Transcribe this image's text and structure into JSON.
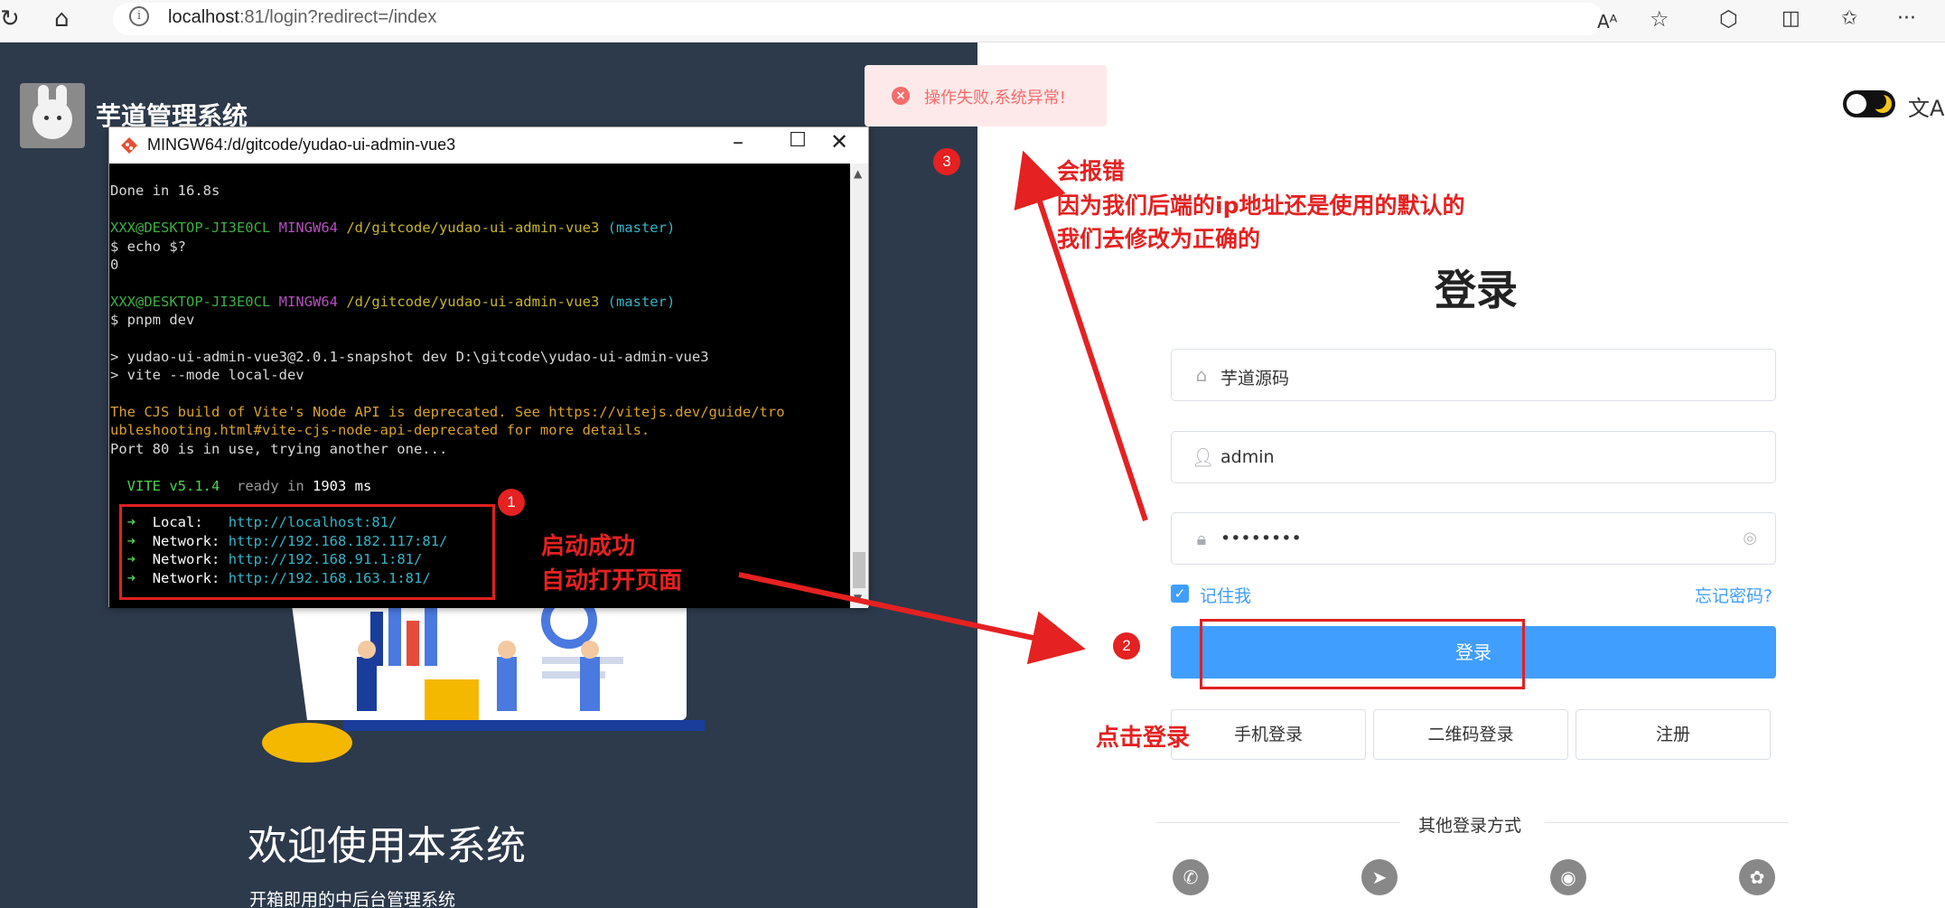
{
  "browser": {
    "url_host": "localhost",
    "url_rest": ":81/login?redirect=/index"
  },
  "left": {
    "app_title": "芋道管理系统",
    "welcome": "欢迎使用本系统",
    "welcome_sub": "开箱即用的中后台管理系统"
  },
  "terminal": {
    "title": "MINGW64:/d/gitcode/yudao-ui-admin-vue3",
    "lines": {
      "done": "Done in 16.8s",
      "user1": "XXX@DESKTOP-JI3E0CL",
      "mingw1": "MINGW64",
      "path1": "/d/gitcode/yudao-ui-admin-vue3",
      "branch1": "(master)",
      "cmd1": "$ echo $?",
      "out1": "0",
      "user2": "XXX@DESKTOP-JI3E0CL",
      "mingw2": "MINGW64",
      "path2": "/d/gitcode/yudao-ui-admin-vue3",
      "branch2": "(master)",
      "cmd2": "$ pnpm dev",
      "run1": "> yudao-ui-admin-vue3@2.0.1-snapshot dev D:\\gitcode\\yudao-ui-admin-vue3",
      "run2": "> vite --mode local-dev",
      "warn1": "The CJS build of Vite's Node API is deprecated. See https://vitejs.dev/guide/tro",
      "warn2": "ubleshooting.html#vite-cjs-node-api-deprecated for more details.",
      "port": "Port 80 is in use, trying another one...",
      "vite_name": "VITE v5.1.4",
      "vite_ready": "ready in",
      "vite_ms": "1903 ms",
      "local_label": "Local:",
      "local_url": "http://localhost:81/",
      "net_label": "Network:",
      "net1": "http://192.168.182.117:81/",
      "net2": "http://192.168.91.1:81/",
      "net3": "http://192.168.163.1:81/"
    }
  },
  "annotations": {
    "badge1": "1",
    "badge2": "2",
    "badge3": "3",
    "startup_line1": "启动成功",
    "startup_line2": "自动打开页面",
    "error_line1": "会报错",
    "error_line2": "因为我们后端的ip地址还是使用的默认的",
    "error_line3": "我们去修改为正确的",
    "click_login": "点击登录"
  },
  "toast": {
    "message": "操作失败,系统异常!"
  },
  "login": {
    "title": "登录",
    "tenant": "芋道源码",
    "username": "admin",
    "password": "••••••••",
    "remember": "记住我",
    "forgot": "忘记密码?",
    "submit": "登录",
    "phone_login": "手机登录",
    "qr_login": "二维码登录",
    "register": "注册",
    "other_methods": "其他登录方式"
  },
  "colors": {
    "accent": "#409eff",
    "error": "#f56c6c",
    "annotation_red": "#e52121",
    "left_bg": "#2d3a4b"
  }
}
